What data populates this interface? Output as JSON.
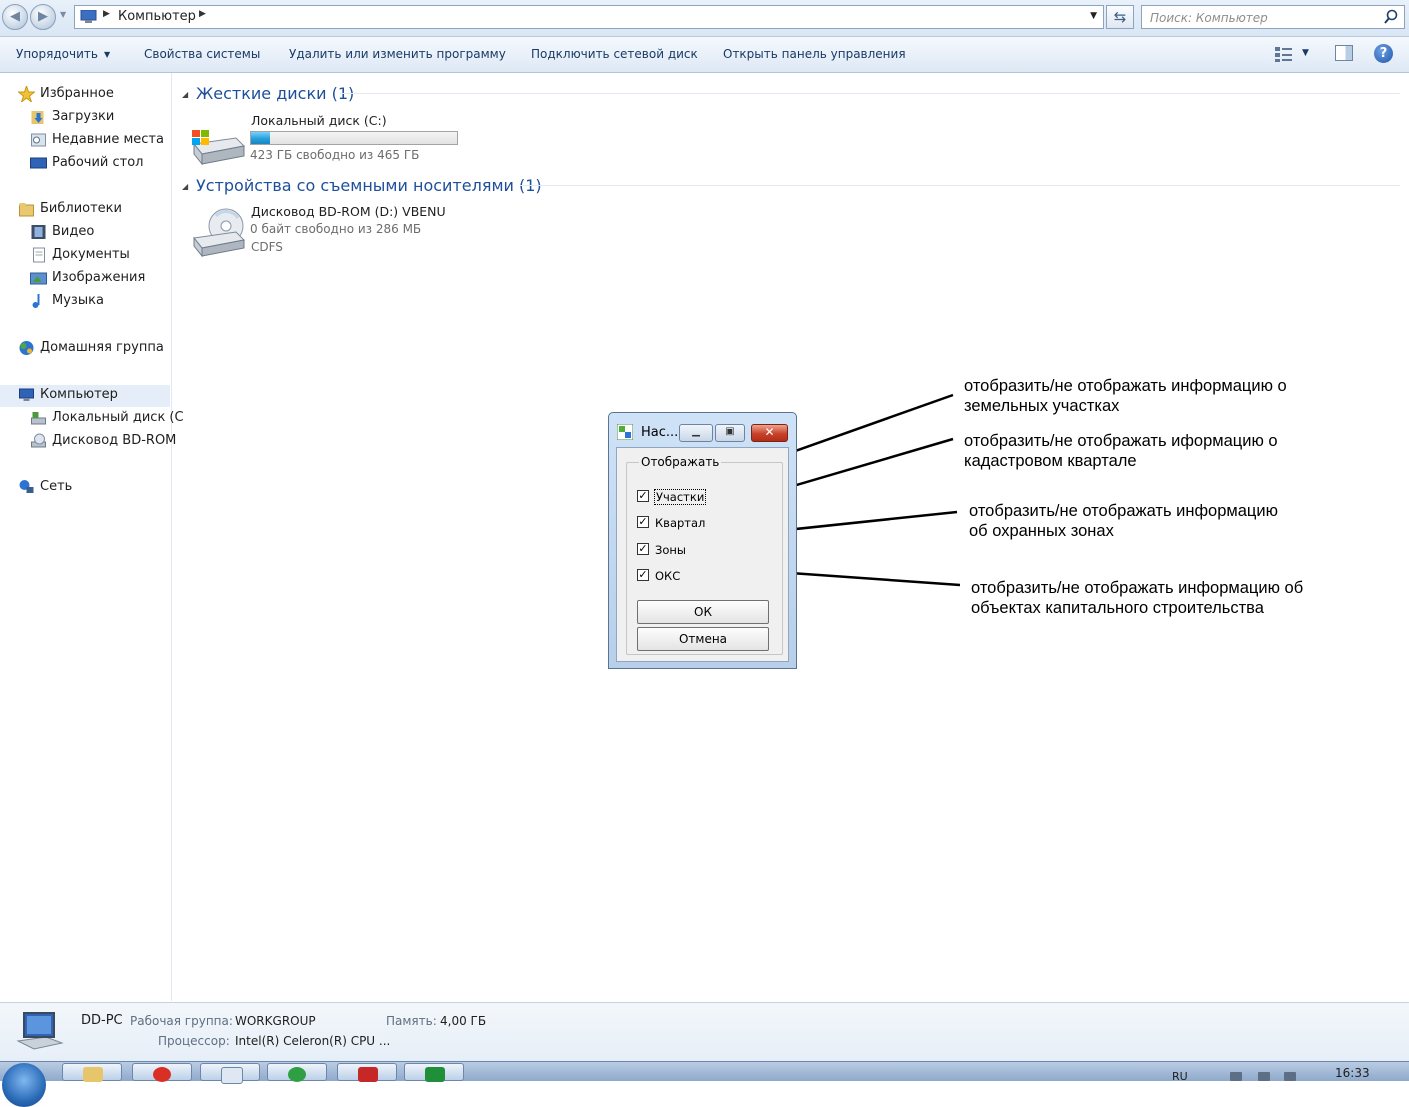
{
  "address": {
    "breadcrumb": "Компьютер",
    "search_placeholder": "Поиск: Компьютер"
  },
  "toolbar": {
    "organize": "Упорядочить",
    "system_properties": "Свойства системы",
    "uninstall": "Удалить или изменить программу",
    "map_drive": "Подключить сетевой диск",
    "control_panel": "Открыть панель управления"
  },
  "sidebar": {
    "favorites": "Избранное",
    "downloads": "Загрузки",
    "recent": "Недавние места",
    "desktop": "Рабочий стол",
    "libraries": "Библиотеки",
    "video": "Видео",
    "documents": "Документы",
    "images": "Изображения",
    "music": "Музыка",
    "homegroup": "Домашняя группа",
    "computer": "Компьютер",
    "local_disk": "Локальный диск (C",
    "bdrom": "Дисковод BD-ROM",
    "network": "Сеть"
  },
  "content": {
    "hdd_group": "Жесткие диски (1)",
    "removable_group": "Устройства со съемными носителями (1)",
    "drive_c": {
      "name": "Локальный диск (C:)",
      "free": "423 ГБ свободно из 465 ГБ",
      "used_fraction": 0.09
    },
    "drive_d": {
      "name": "Дисковод BD-ROM (D:) VBENU",
      "free": "0 байт свободно из 286 МБ",
      "fs": "CDFS"
    }
  },
  "dialog": {
    "title": "Нас...",
    "group": "Отображать",
    "checkboxes": [
      {
        "label": "Участки",
        "checked": true
      },
      {
        "label": "Квартал",
        "checked": true
      },
      {
        "label": "Зоны",
        "checked": true
      },
      {
        "label": "ОКС",
        "checked": true
      }
    ],
    "ok": "ОК",
    "cancel": "Отмена"
  },
  "annotations": [
    "отобразить/не отображать  информацию о\nземельных участках",
    "отобразить/не отображать иформацию о\nкадастровом квартале",
    "отобразить/не отображать  информацию\nоб охранных зонах",
    "отобразить/не отображать информацию об\nобъектах капитального строительства"
  ],
  "details": {
    "pc_name": "DD-PC",
    "workgroup_label": "Рабочая группа:",
    "workgroup": "WORKGROUP",
    "memory_label": "Память:",
    "memory": "4,00 ГБ",
    "cpu_label": "Процессор:",
    "cpu": "Intel(R) Celeron(R) CPU ..."
  },
  "taskbar": {
    "lang": "RU",
    "time": "16:33"
  },
  "colors": {
    "accent": "#1e4f9b",
    "close_button": "#c8412a"
  }
}
